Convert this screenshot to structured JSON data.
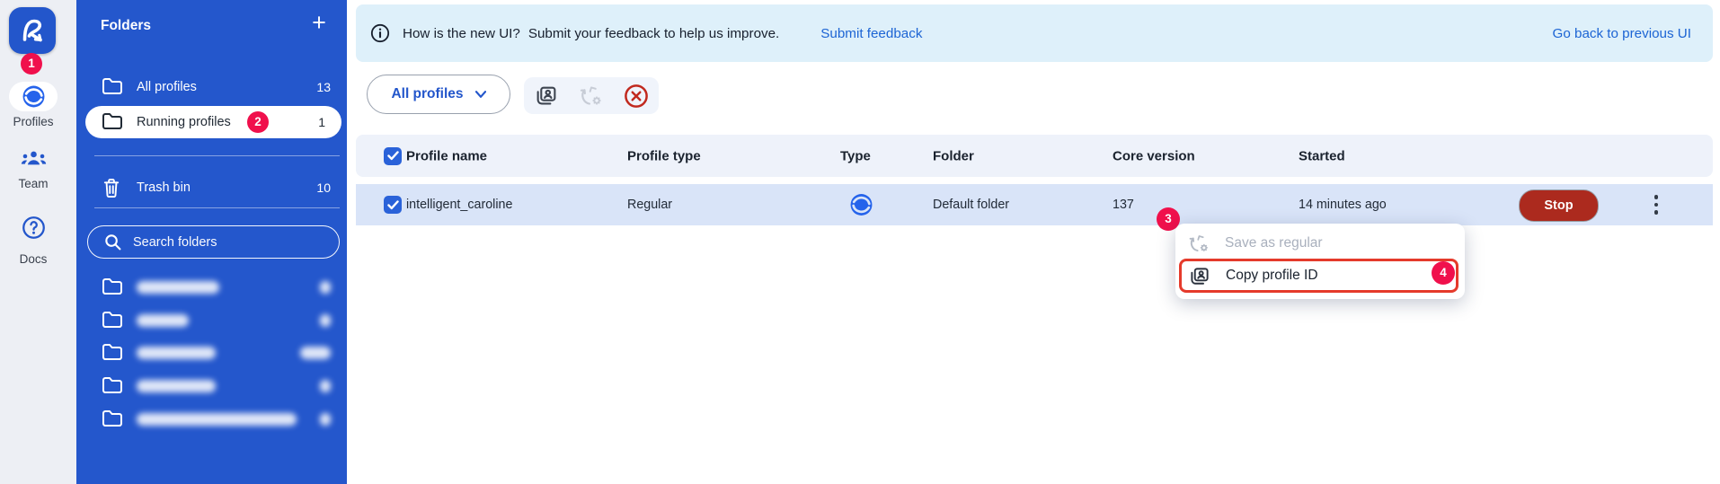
{
  "badges": {
    "s1": "1",
    "s2": "2",
    "s3": "3",
    "s4": "4"
  },
  "rail": {
    "items": [
      {
        "label": "Profiles"
      },
      {
        "label": "Team"
      },
      {
        "label": "Docs"
      }
    ]
  },
  "folders": {
    "title": "Folders",
    "add_label": "+",
    "all": {
      "label": "All profiles",
      "count": "13"
    },
    "running": {
      "label": "Running profiles",
      "count": "1"
    },
    "trash": {
      "label": "Trash bin",
      "count": "10"
    },
    "search_placeholder": "Search folders"
  },
  "banner": {
    "question": "How is the new UI?",
    "message": "Submit your feedback to help us improve.",
    "submit_link": "Submit feedback",
    "back_link": "Go back to previous UI"
  },
  "toolbar": {
    "filter_label": "All profiles",
    "icons": [
      "copy-profile-id-icon",
      "save-as-regular-icon",
      "stop-all-icon"
    ]
  },
  "table": {
    "columns": [
      "Profile name",
      "Profile type",
      "Type",
      "Folder",
      "Core version",
      "Started"
    ],
    "rows": [
      {
        "name": "intelligent_caroline",
        "profile_type": "Regular",
        "type_icon": "mimic-browser-icon",
        "folder": "Default folder",
        "core_version": "137",
        "started": "14 minutes ago",
        "action": "Stop",
        "selected": true
      }
    ]
  },
  "context_menu": {
    "items": [
      {
        "label": "Save as regular",
        "disabled": true
      },
      {
        "label": "Copy profile ID",
        "disabled": false,
        "highlighted": true
      }
    ]
  },
  "colors": {
    "panel_blue": "#2457CC",
    "badge_pink": "#F0104C",
    "stop_red": "#AC2A1E",
    "highlight_red": "#E53A2B",
    "link_blue": "#1C64D4",
    "banner_bg": "#DEF0FA",
    "row_selected_bg": "#D9E4F8",
    "header_bg": "#EEF2FA"
  }
}
